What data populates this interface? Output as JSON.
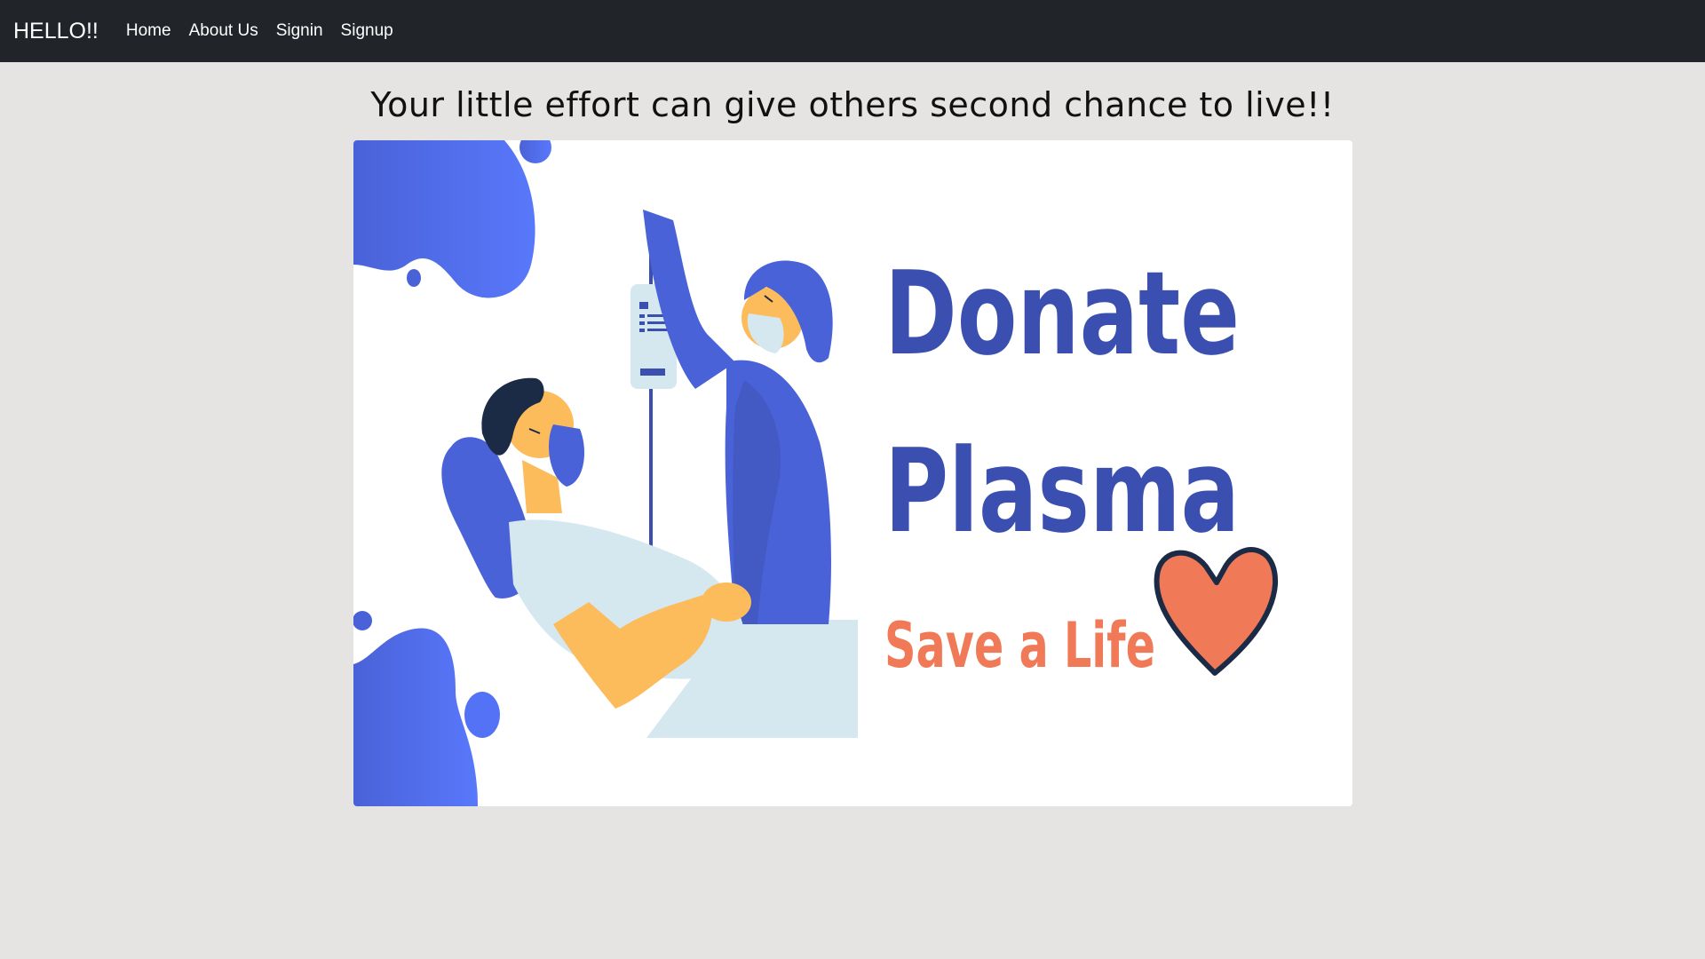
{
  "navbar": {
    "brand": "HELLO!!",
    "links": [
      {
        "label": "Home"
      },
      {
        "label": "About Us"
      },
      {
        "label": "Signin"
      },
      {
        "label": "Signup"
      }
    ]
  },
  "main": {
    "tagline": "Your little effort can give others second chance to live!!",
    "banner": {
      "line1": "Donate",
      "line2": "Plasma",
      "line3": "Save a Life",
      "colors": {
        "primary_blue": "#3b4fb0",
        "accent_blue": "#5472f5",
        "orange": "#f07a58",
        "skin": "#fcbc5c",
        "light_blue": "#d5e8f0",
        "dark_navy": "#1c2b45"
      }
    }
  }
}
